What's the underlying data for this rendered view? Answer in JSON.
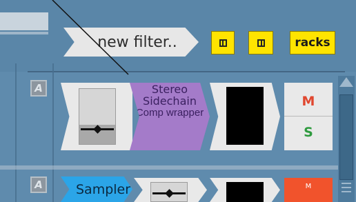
{
  "toolbar": {
    "new_filter_label": "new filter..",
    "racks_label": "racks"
  },
  "channels": [
    {
      "label": "A"
    },
    {
      "label": "A"
    }
  ],
  "row1": {
    "plugin_line1": "Stereo",
    "plugin_line2": "Sidechain",
    "plugin_line3": "Comp wrapper",
    "mute_label": "M",
    "solo_label": "S"
  },
  "row2": {
    "plugin_label": "Sampler",
    "mute_label": "M"
  },
  "colors": {
    "background": "#5f8bad",
    "button_yellow": "#ffe400",
    "plugin_purple": "#a47bc9",
    "plugin_blue": "#2ba5e8",
    "mute_red": "#e0472f",
    "solo_green": "#2e9a3e",
    "mute_active": "#f1532c"
  },
  "icons": {
    "left_panel_toggle": "panel-left-icon",
    "right_panel_toggle": "panel-right-icon"
  }
}
